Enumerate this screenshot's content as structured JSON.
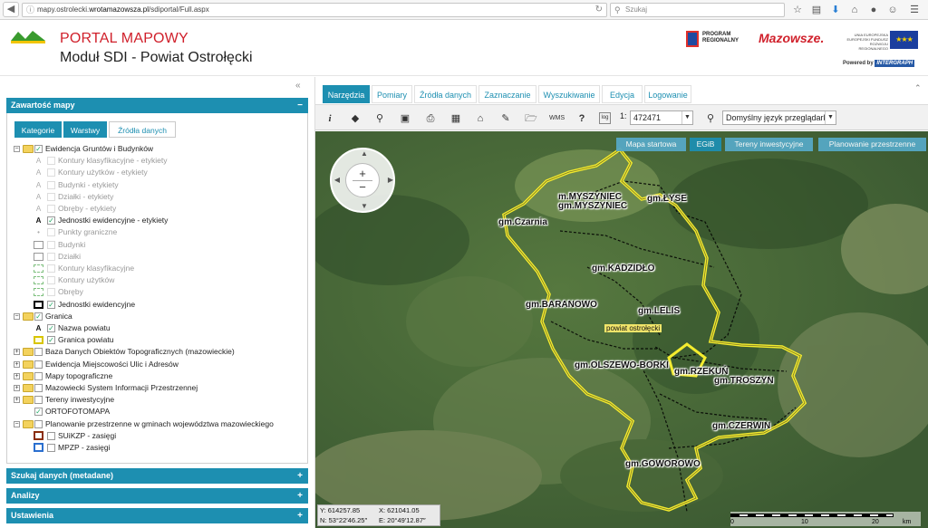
{
  "browser": {
    "url_prefix": "mapy.ostrolecki.",
    "url_domain": "wrotamazowsza.pl",
    "url_path": "/sdiportal/Full.aspx",
    "search_placeholder": "Szukaj"
  },
  "header": {
    "title": "PORTAL MAPOWY",
    "subtitle": "Moduł SDI - Powiat Ostrołęcki",
    "program_text": "PROGRAM REGIONALNY",
    "mazowsze": "Mazowsze.",
    "eu_text": "UNIA EUROPEJSKA EUROPEJSKI FUNDUSZ ROZWOJU REGIONALNEGO",
    "powered_by": "Powered by",
    "intergraph": "INTERGRAPH"
  },
  "left_panel": {
    "header": "Zawartość mapy",
    "tabs": [
      "Kategorie",
      "Warstwy",
      "Źródła danych"
    ],
    "bottom_panels": [
      "Szukaj danych (metadane)",
      "Analizy",
      "Ustawienia"
    ]
  },
  "tree": [
    {
      "label": "Ewidencja Gruntów i Budynków",
      "level": 0,
      "checked": true,
      "folder": true,
      "expanded": true
    },
    {
      "label": "Kontury klasyfikacyjne - etykiety",
      "level": 1,
      "icon": "A",
      "disabled": true
    },
    {
      "label": "Kontury użytków - etykiety",
      "level": 1,
      "icon": "A",
      "disabled": true
    },
    {
      "label": "Budynki - etykiety",
      "level": 1,
      "icon": "A",
      "disabled": true
    },
    {
      "label": "Działki - etykiety",
      "level": 1,
      "icon": "A",
      "disabled": true
    },
    {
      "label": "Obręby - etykiety",
      "level": 1,
      "icon": "A",
      "disabled": true
    },
    {
      "label": "Jednostki ewidencyjne - etykiety",
      "level": 1,
      "icon": "A",
      "checked": true
    },
    {
      "label": "Punkty graniczne",
      "level": 1,
      "icon": "•",
      "disabled": true
    },
    {
      "label": "Budynki",
      "level": 1,
      "icon": "box",
      "disabled": true
    },
    {
      "label": "Działki",
      "level": 1,
      "icon": "box",
      "disabled": true
    },
    {
      "label": "Kontury klasyfikacyjne",
      "level": 1,
      "icon": "dash",
      "disabled": true
    },
    {
      "label": "Kontury użytków",
      "level": 1,
      "icon": "dash",
      "disabled": true
    },
    {
      "label": "Obręby",
      "level": 1,
      "icon": "dash",
      "disabled": true
    },
    {
      "label": "Jednostki ewidencyjne",
      "level": 1,
      "icon": "dashblack",
      "checked": true
    },
    {
      "label": "Granica",
      "level": 0,
      "checked": true,
      "folder": true,
      "expanded": true
    },
    {
      "label": "Nazwa powiatu",
      "level": 1,
      "icon": "A",
      "checked": true
    },
    {
      "label": "Granica powiatu",
      "level": 1,
      "icon": "yellowbox",
      "checked": true
    },
    {
      "label": "Baza Danych Obiektów Topograficznych (mazowieckie)",
      "level": 0,
      "folder": true
    },
    {
      "label": "Ewidencja Miejscowości Ulic i Adresów",
      "level": 0,
      "folder": true
    },
    {
      "label": "Mapy topograficzne",
      "level": 0,
      "folder": true
    },
    {
      "label": "Mazowiecki System Informacji Przestrzennej",
      "level": 0,
      "folder": true
    },
    {
      "label": "Tereny inwestycyjne",
      "level": 0,
      "folder": true
    },
    {
      "label": "ORTOFOTOMAPA",
      "level": 0,
      "checked": true,
      "noexp": true
    },
    {
      "label": "Planowanie przestrzenne w gminach województwa mazowieckiego",
      "level": 0,
      "folder": true,
      "expanded": true
    },
    {
      "label": "SUiKZP - zasięgi",
      "level": 1,
      "icon": "redbox"
    },
    {
      "label": "MPZP - zasięgi",
      "level": 1,
      "icon": "bluebox"
    }
  ],
  "main_tabs": [
    "Narzędzia",
    "Pomiary",
    "Źródła danych",
    "Zaznaczanie",
    "Wyszukiwanie",
    "Edycja",
    "Logowanie"
  ],
  "toolbar": {
    "scale_prefix": "1:",
    "scale_value": "472471",
    "language": "Domyślny język przeglądarki"
  },
  "map": {
    "tabs": [
      "Mapa startowa",
      "EGiB",
      "Tereny inwestycyjne",
      "Planowanie przestrzenne"
    ],
    "labels": [
      {
        "text": "m.MYSZYNIEC",
        "id": "m-myszyniec-a"
      },
      {
        "text": "gm.MYSZYNIEC",
        "id": "gm-myszyniec"
      },
      {
        "text": "gm.ŁYSE",
        "id": "gm-lyse"
      },
      {
        "text": "gm.Czarnia",
        "id": "gm-czarnia"
      },
      {
        "text": "gm.KADZIDŁO",
        "id": "gm-kadzidlo"
      },
      {
        "text": "gm.BARANOWO",
        "id": "gm-baranowo"
      },
      {
        "text": "gm.LELIS",
        "id": "gm-lelis"
      },
      {
        "text": "gm.OLSZEWO-BORKI",
        "id": "gm-olszewo"
      },
      {
        "text": "gm.RZEKUŃ",
        "id": "gm-rzekun"
      },
      {
        "text": "gm.TROSZYN",
        "id": "gm-troszyn"
      },
      {
        "text": "gm.CZERWIN",
        "id": "gm-czerwin"
      },
      {
        "text": "gm.GOWOROWO",
        "id": "gm-goworowo"
      }
    ],
    "county_label": "powiat ostrołęcki",
    "coords": {
      "y": "Y: 614257.85",
      "x": "X: 621041.05",
      "n": "N: 53°22′46.25″",
      "e": "E: 20°49′12.87″"
    },
    "scalebar": [
      "0",
      "10",
      "20",
      "km"
    ]
  }
}
